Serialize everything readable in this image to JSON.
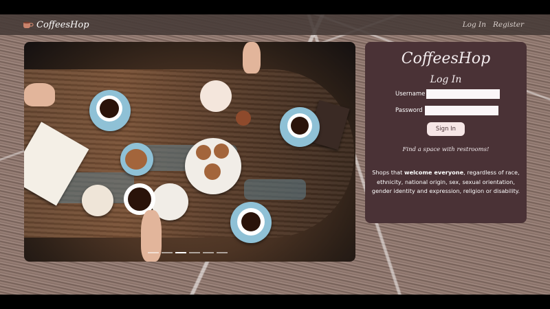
{
  "navbar": {
    "brand": "CoffeesHop",
    "brand_icon": "coffee-cup-icon",
    "links": {
      "login": "Log In",
      "register": "Register"
    }
  },
  "hero": {
    "slides_count": 6,
    "active_slide": 3
  },
  "card": {
    "title": "CoffeesHop",
    "subtitle": "Log In",
    "username_label": "Username",
    "password_label": "Password",
    "signin_label": "Sign In",
    "tagline": "Find a space with restrooms!",
    "desc_pre": "Shops that ",
    "desc_bold": "welcome everyone",
    "desc_post": ", regardless of race, ethnicity, national origin, sex, sexual orientation, gender identity and expression, religion or disability."
  },
  "colors": {
    "navbar": "#463a37",
    "card": "#4a3236",
    "button": "#f6e6e6"
  }
}
